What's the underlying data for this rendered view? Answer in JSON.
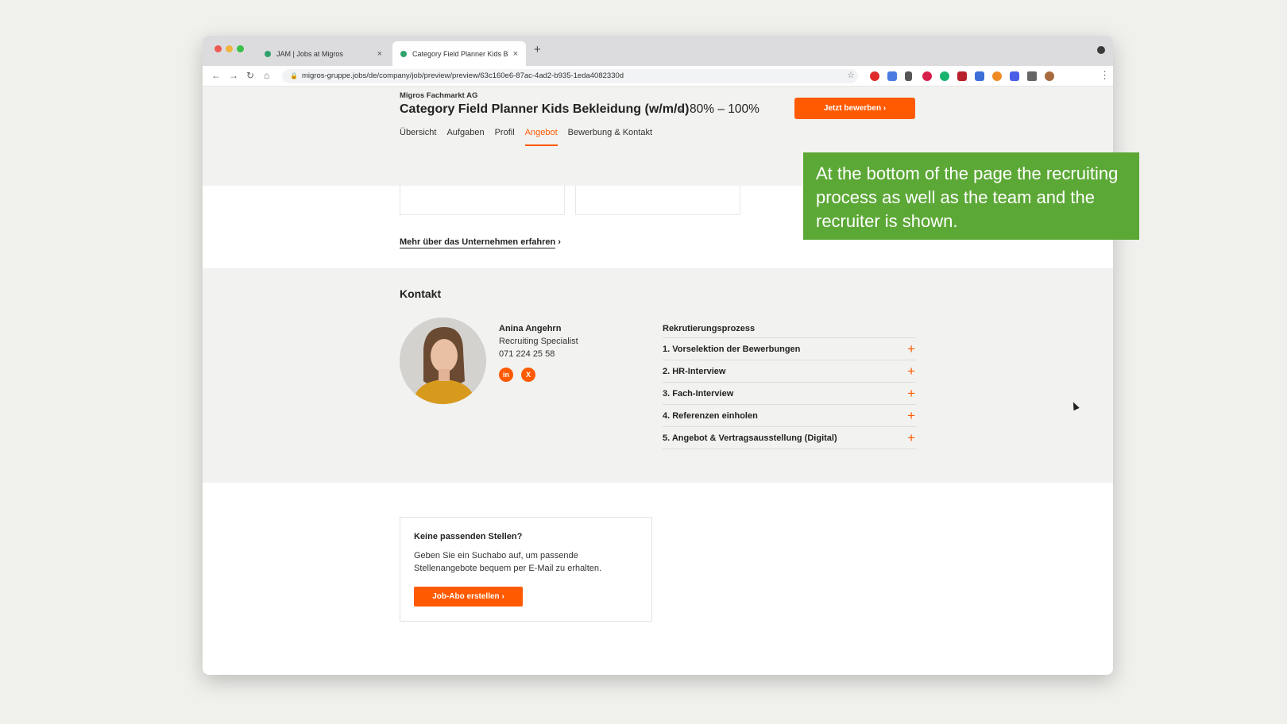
{
  "browser": {
    "tabs": [
      {
        "title": "JAM | Jobs at Migros",
        "active": false
      },
      {
        "title": "Category Field Planner Kids Be",
        "active": true
      }
    ],
    "url": "migros-gruppe.jobs/de/company/job/preview/preview/63c160e6-87ac-4ad2-b935-1eda4082330d",
    "close_glyph": "×",
    "new_tab_glyph": "+"
  },
  "job": {
    "company": "Migros Fachmarkt AG",
    "title": "Category Field Planner Kids Bekleidung (w/m/d)",
    "separator": "•",
    "workload": "80% – 100%",
    "apply_label": "Jetzt bewerben ›"
  },
  "nav": {
    "tabs": [
      "Übersicht",
      "Aufgaben",
      "Profil",
      "Angebot",
      "Bewerbung & Kontakt"
    ],
    "active": "Angebot"
  },
  "more_link": {
    "label": "Mehr über das Unternehmen erfahren",
    "arrow": "›"
  },
  "contact": {
    "heading": "Kontakt",
    "name": "Anina Angehrn",
    "role": "Recruiting Specialist",
    "phone": "071 224 25 58",
    "social": [
      "in",
      "X"
    ]
  },
  "recruiting": {
    "heading": "Rekrutierungsprozess",
    "steps": [
      "1. Vorselektion der Bewerbungen",
      "2. HR-Interview",
      "3. Fach-Interview",
      "4. Referenzen einholen",
      "5. Angebot & Vertragsausstellung (Digital)"
    ],
    "expand_glyph": "+"
  },
  "job_abo": {
    "title": "Keine passenden Stellen?",
    "text": "Geben Sie ein Suchabo auf, um passende Stellenangebote bequem per E-Mail zu erhalten.",
    "button": "Job-Abo erstellen ›"
  },
  "callout": {
    "text": "At the bottom of the page the recruiting process as well as the team and the recruiter is shown."
  },
  "colors": {
    "accent": "#ff5a00",
    "callout_bg": "#5ca836",
    "section_bg": "#f2f2f0"
  }
}
